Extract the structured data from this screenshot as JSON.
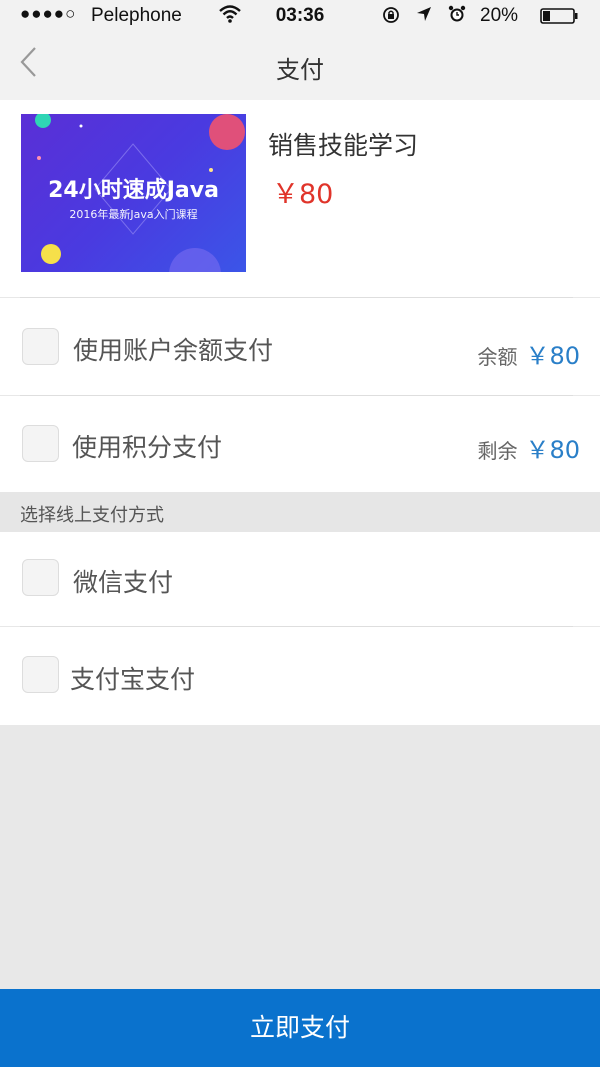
{
  "status_bar": {
    "signal": "●●●●○",
    "carrier": "Pelephone",
    "time": "03:36",
    "battery_percent": "20%"
  },
  "nav": {
    "title": "支付"
  },
  "product": {
    "thumbnail_title": "24小时速成Java",
    "thumbnail_subtitle": "2016年最新Java入门课程",
    "name": "销售技能学习",
    "price": "￥80"
  },
  "options": {
    "balance": {
      "label": "使用账户余额支付",
      "right_label": "余额",
      "right_amount": "￥80"
    },
    "points": {
      "label": "使用积分支付",
      "right_label": "剩余",
      "right_amount": "￥80"
    }
  },
  "online_section": {
    "header": "选择线上支付方式",
    "methods": [
      {
        "label": "微信支付"
      },
      {
        "label": "支付宝支付"
      }
    ]
  },
  "pay_button": {
    "label": "立即支付"
  },
  "colors": {
    "accent_blue": "#0a72cd",
    "price_red": "#e0342a",
    "amount_blue": "#2a7fc8"
  }
}
